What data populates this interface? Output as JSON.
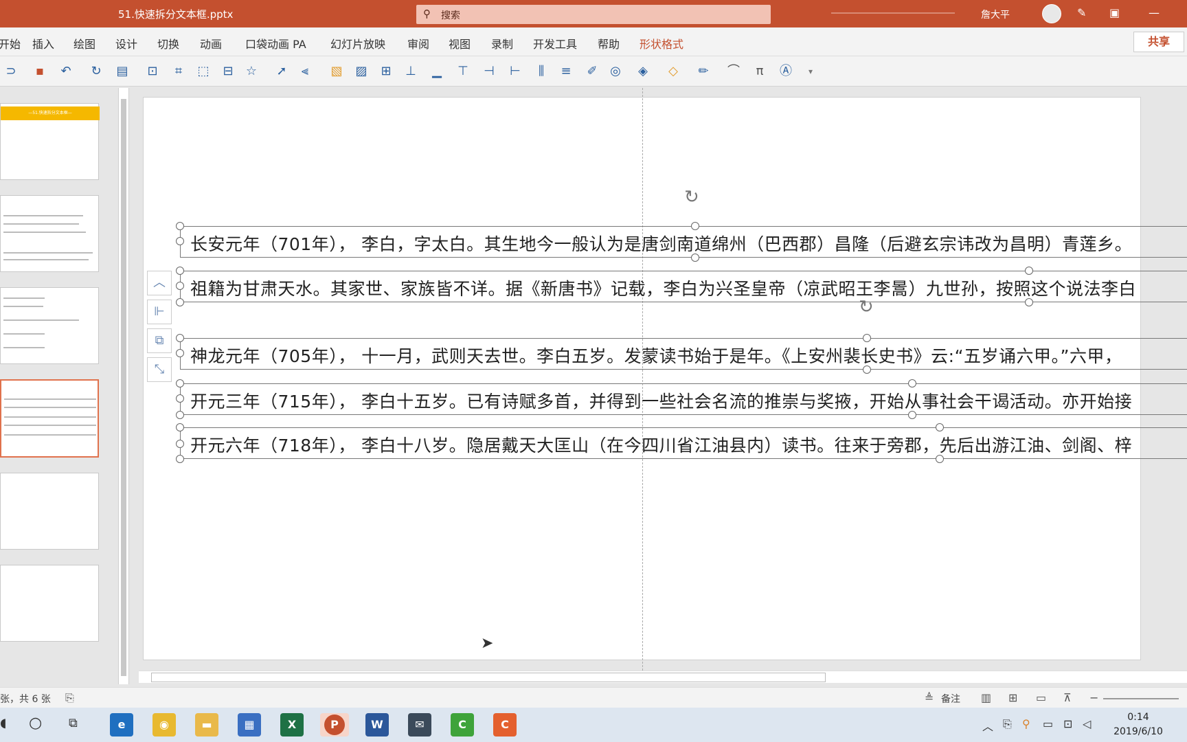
{
  "window": {
    "doc_title": "51.快速拆分文本框.pptx",
    "search_placeholder": "搜索",
    "user_name": "詹大平"
  },
  "tabs": [
    {
      "label": "开始"
    },
    {
      "label": "插入"
    },
    {
      "label": "绘图"
    },
    {
      "label": "设计"
    },
    {
      "label": "切换"
    },
    {
      "label": "动画"
    },
    {
      "label": "口袋动画 PA"
    },
    {
      "label": "幻灯片放映"
    },
    {
      "label": "审阅"
    },
    {
      "label": "视图"
    },
    {
      "label": "录制"
    },
    {
      "label": "开发工具"
    },
    {
      "label": "帮助"
    },
    {
      "label": "形状格式"
    }
  ],
  "share_label": "共享",
  "thumbnails": {
    "first_banner": "—51.快速拆分文本框—"
  },
  "textboxes": [
    {
      "text": "长安元年（701年），  李白，字太白。其生地今一般认为是唐剑南道绵州（巴西郡）昌隆（后避玄宗讳改为昌明）青莲乡。"
    },
    {
      "text": "祖籍为甘肃天水。其家世、家族皆不详。据《新唐书》记载，李白为兴圣皇帝（凉武昭王李暠）九世孙，按照这个说法李白"
    },
    {
      "text": "神龙元年（705年），  十一月，武则天去世。李白五岁。发蒙读书始于是年。《上安州裴长史书》云:“五岁诵六甲。”六甲，"
    },
    {
      "text": "开元三年（715年），  李白十五岁。已有诗赋多首，并得到一些社会名流的推崇与奖掖，开始从事社会干谒活动。亦开始接"
    },
    {
      "text": "开元六年（718年），  李白十八岁。隐居戴天大匡山（在今四川省江油县内）读书。往来于旁郡，先后出游江油、剑阁、梓"
    }
  ],
  "status": {
    "slide_count": "张，共 6 张",
    "notes_label": "备注"
  },
  "clock": {
    "time": "0:14",
    "date": "2019/6/10"
  },
  "colors": {
    "accent": "#c4502f",
    "search_bg": "#f2c2b4"
  }
}
